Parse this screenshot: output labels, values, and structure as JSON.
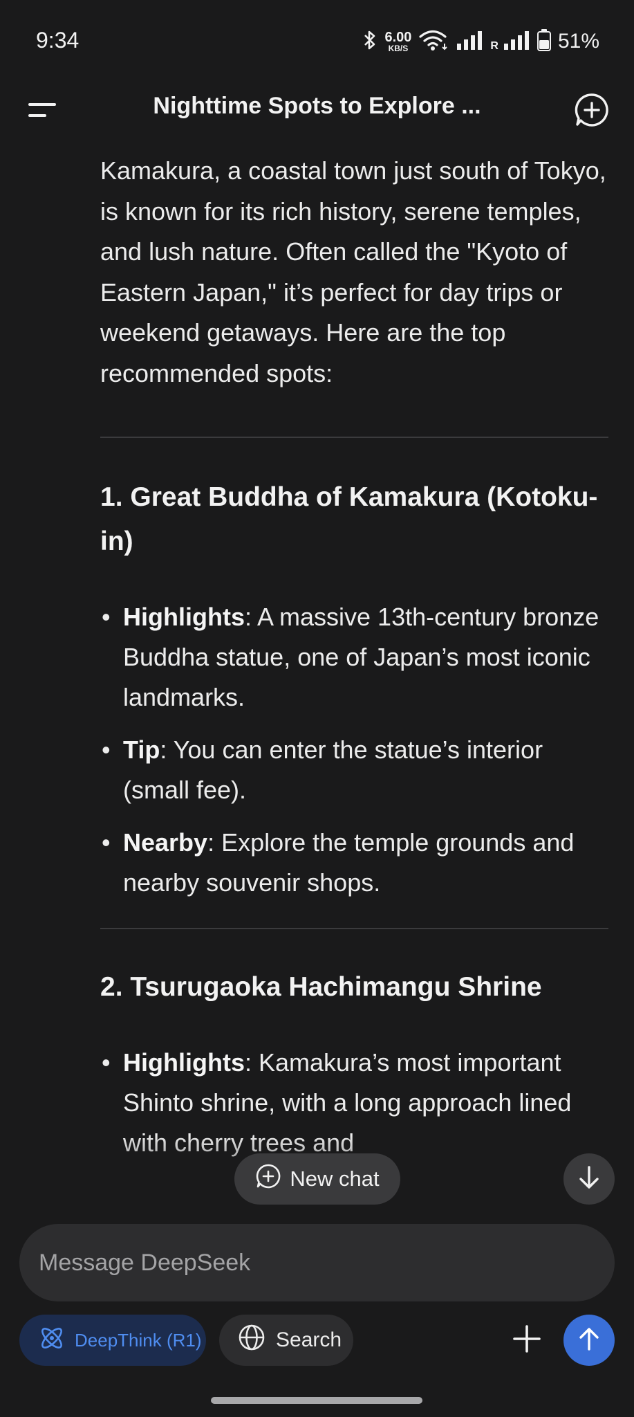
{
  "status_bar": {
    "time": "9:34",
    "net_speed_value": "6.00",
    "net_speed_unit": "KB/S",
    "roaming_label": "R",
    "battery": "51%"
  },
  "header": {
    "title": "Nighttime Spots to Explore ..."
  },
  "content": {
    "intro": "Kamakura, a coastal town just south of Tokyo, is known for its rich history, serene temples, and lush nature. Often called the \"Kyoto of Eastern Japan,\" it’s perfect for day trips or weekend getaways. Here are the top recommended spots:",
    "sections": [
      {
        "heading": "1. Great Buddha of Kamakura (Kotoku-in)",
        "bullets": [
          {
            "label": "Highlights",
            "text": ": A massive 13th-century bronze Buddha statue, one of Japan’s most iconic landmarks."
          },
          {
            "label": "Tip",
            "text": ": You can enter the statue’s interior (small fee)."
          },
          {
            "label": "Nearby",
            "text": ": Explore the temple grounds and nearby souvenir shops."
          }
        ]
      },
      {
        "heading": "2. Tsurugaoka Hachimangu Shrine",
        "bullets": [
          {
            "label": "Highlights",
            "text": ": Kamakura’s most important Shinto shrine, with a long approach lined with cherry trees and"
          }
        ]
      }
    ]
  },
  "floating": {
    "new_chat_label": "New chat"
  },
  "composer": {
    "placeholder": "Message DeepSeek",
    "deepthink_label": "DeepThink (R1)",
    "search_label": "Search"
  },
  "colors": {
    "background": "#1a1a1b",
    "surface": "#2d2d2f",
    "accent": "#4f8df0",
    "send": "#3a6fd8"
  }
}
